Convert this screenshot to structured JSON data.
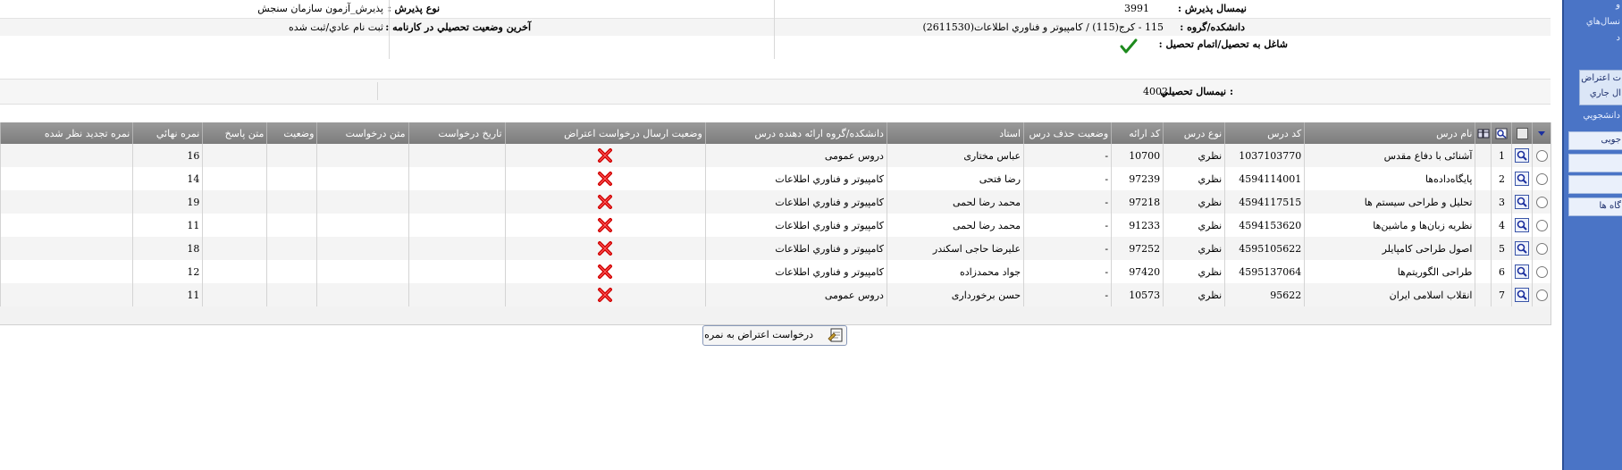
{
  "info": {
    "admission_term_label": "نيمسال پذيرش :",
    "admission_term_value": "3991",
    "admission_type_label": "نوع پذيرش :",
    "admission_type_value": "پذيرش_آزمون سازمان سنجش",
    "faculty_label": "دانشكده/گروه :",
    "faculty_value": "115 - كرج(115) / كامپيوتر و فناوري اطلاعات(2611530)",
    "last_status_label": "آخرين وضعيت تحصيلي در کارنامه :",
    "last_status_value": "ثبت نام عادي/ثبت شده",
    "studying_label": "شاغل به تحصيل/اتمام تحصيل :",
    "term_label": "نيمسال تحصيلي :",
    "term_value": "4002"
  },
  "grid": {
    "columns": {
      "course_name": "نام درس",
      "course_code": "كد درس",
      "course_type": "نوع درس",
      "offer_code": "كد ارائه",
      "drop_status": "وضعيت حذف درس",
      "instructor": "استاد",
      "faculty": "دانشكده/گروه ارائه دهنده درس",
      "objection_status": "وضعيت ارسال درخواست اعتراض",
      "request_date": "تاريخ درخواست",
      "request_text": "متن درخواست",
      "status": "وضعيت",
      "answer_text": "متن پاسخ",
      "final_grade": "نمره نهائي",
      "review_grade": "نمره تجديد نظر شده"
    },
    "rows": [
      {
        "n": "1",
        "name": "آشنائی با دفاع مقدس",
        "code": "1037103770",
        "type": "نظري",
        "offer": "10700",
        "drop": "-",
        "instructor": "عباس مختاری",
        "faculty": "دروس عمومی",
        "grade": "16"
      },
      {
        "n": "2",
        "name": "پايگاه‌داده‌ها",
        "code": "4594114001",
        "type": "نظري",
        "offer": "97239",
        "drop": "-",
        "instructor": "رضا فتحی",
        "faculty": "كامپيوتر و فناوري اطلاعات",
        "grade": "14"
      },
      {
        "n": "3",
        "name": "تحليل و طراحی سيستم ها",
        "code": "4594117515",
        "type": "نظري",
        "offer": "97218",
        "drop": "-",
        "instructor": "محمد رضا لحمی",
        "faculty": "كامپيوتر و فناوري اطلاعات",
        "grade": "19"
      },
      {
        "n": "4",
        "name": "نظريه زبان‌ها و ماشين‌ها",
        "code": "4594153620",
        "type": "نظري",
        "offer": "91233",
        "drop": "-",
        "instructor": "محمد رضا لحمی",
        "faculty": "كامپيوتر و فناوري اطلاعات",
        "grade": "11"
      },
      {
        "n": "5",
        "name": "اصول طراحی کامپايلر",
        "code": "4595105622",
        "type": "نظري",
        "offer": "97252",
        "drop": "-",
        "instructor": "عليرضا حاجی اسکندر",
        "faculty": "كامپيوتر و فناوري اطلاعات",
        "grade": "18"
      },
      {
        "n": "6",
        "name": "طراحی الگوريتم‌ها",
        "code": "4595137064",
        "type": "نظري",
        "offer": "97420",
        "drop": "-",
        "instructor": "جواد محمدزاده",
        "faculty": "كامپيوتر و فناوري اطلاعات",
        "grade": "12"
      },
      {
        "n": "7",
        "name": "انقلاب اسلامی ايران",
        "code": "95622",
        "type": "نظري",
        "offer": "10573",
        "drop": "-",
        "instructor": "حسن برخورداری",
        "faculty": "دروس عمومی",
        "grade": "11"
      }
    ]
  },
  "buttons": {
    "objection_request": "درخواست اعتراض به نمره"
  },
  "sidebar": {
    "fragments": [
      "و",
      "نسال‌هاي",
      "د",
      "ت اعتراض",
      "ال جاري",
      "دانشجويي",
      "جويی",
      "گاه ها"
    ]
  },
  "colors": {
    "grid_header": "#8a8a8a",
    "sidebar": "#4a74c6",
    "reject": "#d00000",
    "check": "#1d8a1d"
  },
  "icons": {
    "row_view": "magnifier-icon",
    "objection": "red-x-icon",
    "studying": "green-check-icon",
    "button": "request-icon"
  }
}
